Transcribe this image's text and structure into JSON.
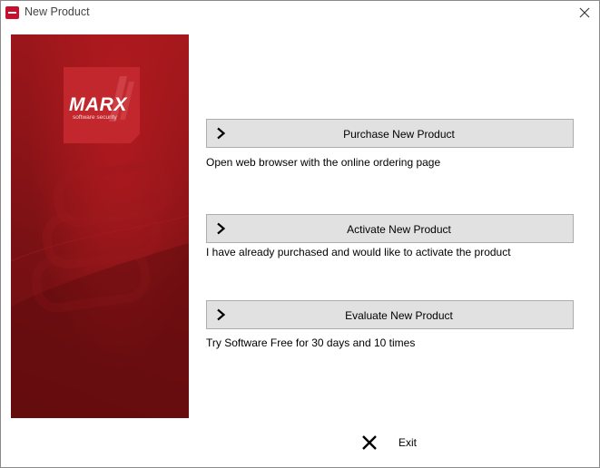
{
  "window": {
    "title": "New Product",
    "close_icon": "close-icon",
    "app_icon": "marx-app-icon"
  },
  "banner": {
    "logo_text": "MARX",
    "logo_subtext": "software security",
    "colors": {
      "primary": "#8e1418",
      "logo": "#c1272d"
    }
  },
  "actions": [
    {
      "label": "Purchase New Product",
      "icon": "chevron-right-icon",
      "description": "Open web browser with the online ordering page"
    },
    {
      "label": "Activate New Product",
      "icon": "chevron-right-icon",
      "description": "I have already purchased and would like to activate the product"
    },
    {
      "label": "Evaluate New Product",
      "icon": "chevron-right-icon",
      "description": "Try Software Free for 30 days and 10 times"
    }
  ],
  "footer": {
    "exit_label": "Exit",
    "exit_icon": "x-icon"
  }
}
